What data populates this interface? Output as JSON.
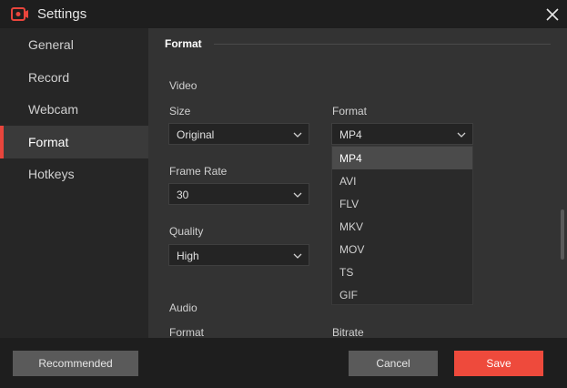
{
  "window": {
    "title": "Settings",
    "accent": "#e8453c"
  },
  "sidebar": {
    "items": [
      {
        "label": "General"
      },
      {
        "label": "Record"
      },
      {
        "label": "Webcam"
      },
      {
        "label": "Format",
        "active": true
      },
      {
        "label": "Hotkeys"
      }
    ]
  },
  "content": {
    "section_title": "Format",
    "video": {
      "heading": "Video",
      "size": {
        "label": "Size",
        "value": "Original"
      },
      "format": {
        "label": "Format",
        "value": "MP4"
      },
      "frame_rate": {
        "label": "Frame Rate",
        "value": "30"
      },
      "quality": {
        "label": "Quality",
        "value": "High"
      }
    },
    "audio": {
      "heading": "Audio",
      "format_label": "Format",
      "bitrate_label": "Bitrate"
    },
    "format_dropdown": {
      "options": [
        "MP4",
        "AVI",
        "FLV",
        "MKV",
        "MOV",
        "TS",
        "GIF"
      ],
      "selected": "MP4"
    }
  },
  "footer": {
    "recommended_label": "Recommended",
    "cancel_label": "Cancel",
    "save_label": "Save"
  }
}
